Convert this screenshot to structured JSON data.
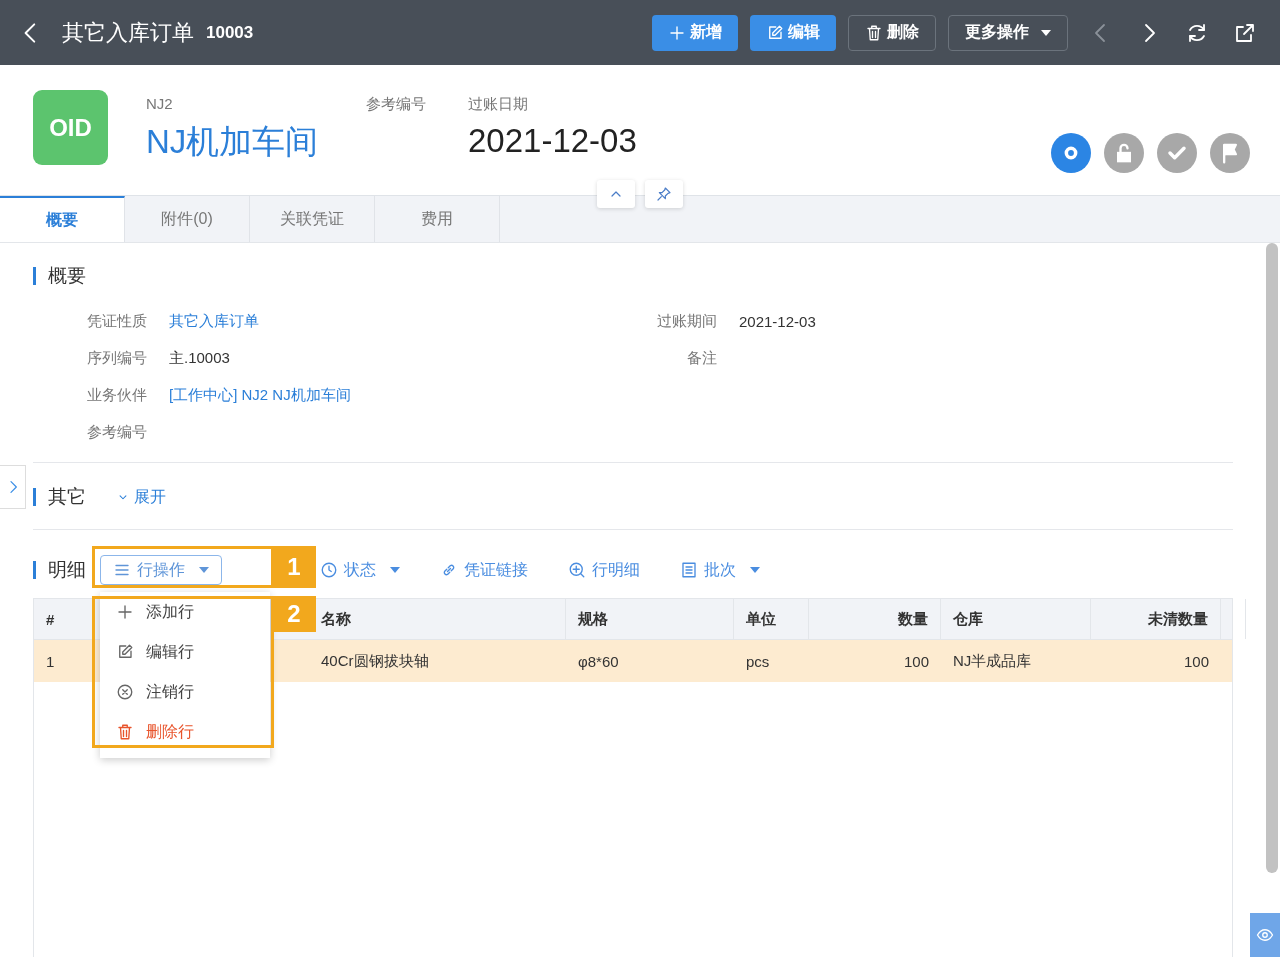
{
  "header": {
    "title": "其它入库订单",
    "number": "10003",
    "actions": [
      {
        "kind": "primary",
        "label": "新增"
      },
      {
        "kind": "primary",
        "label": "编辑"
      },
      {
        "kind": "outline",
        "label": "删除"
      },
      {
        "kind": "dropdown",
        "label": "更多操作"
      }
    ],
    "nav": [
      {
        "disabled": true
      },
      {
        "disabled": false
      },
      {
        "disabled": false
      },
      {
        "disabled": false
      }
    ]
  },
  "summary": {
    "badge": "OID",
    "code": "NJ2",
    "name": "NJ机加车间",
    "ref_label": "参考编号",
    "date_label": "过账日期",
    "date": "2021-12-03",
    "status_steps": [
      {
        "active": true
      },
      {
        "active": false
      },
      {
        "active": false
      },
      {
        "active": false
      }
    ]
  },
  "tabs": [
    {
      "label": "概要",
      "selected": true
    },
    {
      "label": "附件(0)",
      "selected": false
    },
    {
      "label": "关联凭证",
      "selected": false
    },
    {
      "label": "费用",
      "selected": false
    }
  ],
  "overview": {
    "title": "概要",
    "left_fields": [
      {
        "label": "凭证性质",
        "value": "其它入库订单",
        "link": true
      },
      {
        "label": "序列编号",
        "value": "主.10003",
        "link": false
      },
      {
        "label": "业务伙伴",
        "value": "[工作中心] NJ2 NJ机加车间",
        "link": true
      },
      {
        "label": "参考编号"
      }
    ],
    "right_fields": [
      {
        "label": "过账期间",
        "value": "2021-12-03",
        "link": false
      },
      {
        "label": "备注"
      }
    ]
  },
  "other": {
    "title": "其它",
    "toggle": "展开"
  },
  "detail": {
    "title": "明细",
    "toolbar": [
      {
        "label": "行操作",
        "caret": true,
        "outlined": true
      },
      {
        "label": "状态",
        "caret": true,
        "outlined": false
      },
      {
        "label": "凭证链接",
        "caret": false,
        "outlined": false
      },
      {
        "label": "行明细",
        "caret": false,
        "outlined": false
      },
      {
        "label": "批次",
        "caret": true,
        "outlined": false
      }
    ],
    "menu": [
      {
        "label": "添加行",
        "danger": false
      },
      {
        "label": "编辑行",
        "danger": false
      },
      {
        "label": "注销行",
        "danger": false
      },
      {
        "label": "删除行",
        "danger": true
      }
    ],
    "table": {
      "columns": [
        "#",
        "名称",
        "规格",
        "单位",
        "数量",
        "仓库",
        "未清数量"
      ],
      "rows": [
        {
          "selected": true,
          "cells": [
            "1",
            "40Cr圆钢拔块轴",
            "φ8*60",
            "pcs",
            "100",
            "NJ半成品库",
            "100"
          ]
        }
      ]
    }
  },
  "callouts": [
    "1",
    "2"
  ]
}
